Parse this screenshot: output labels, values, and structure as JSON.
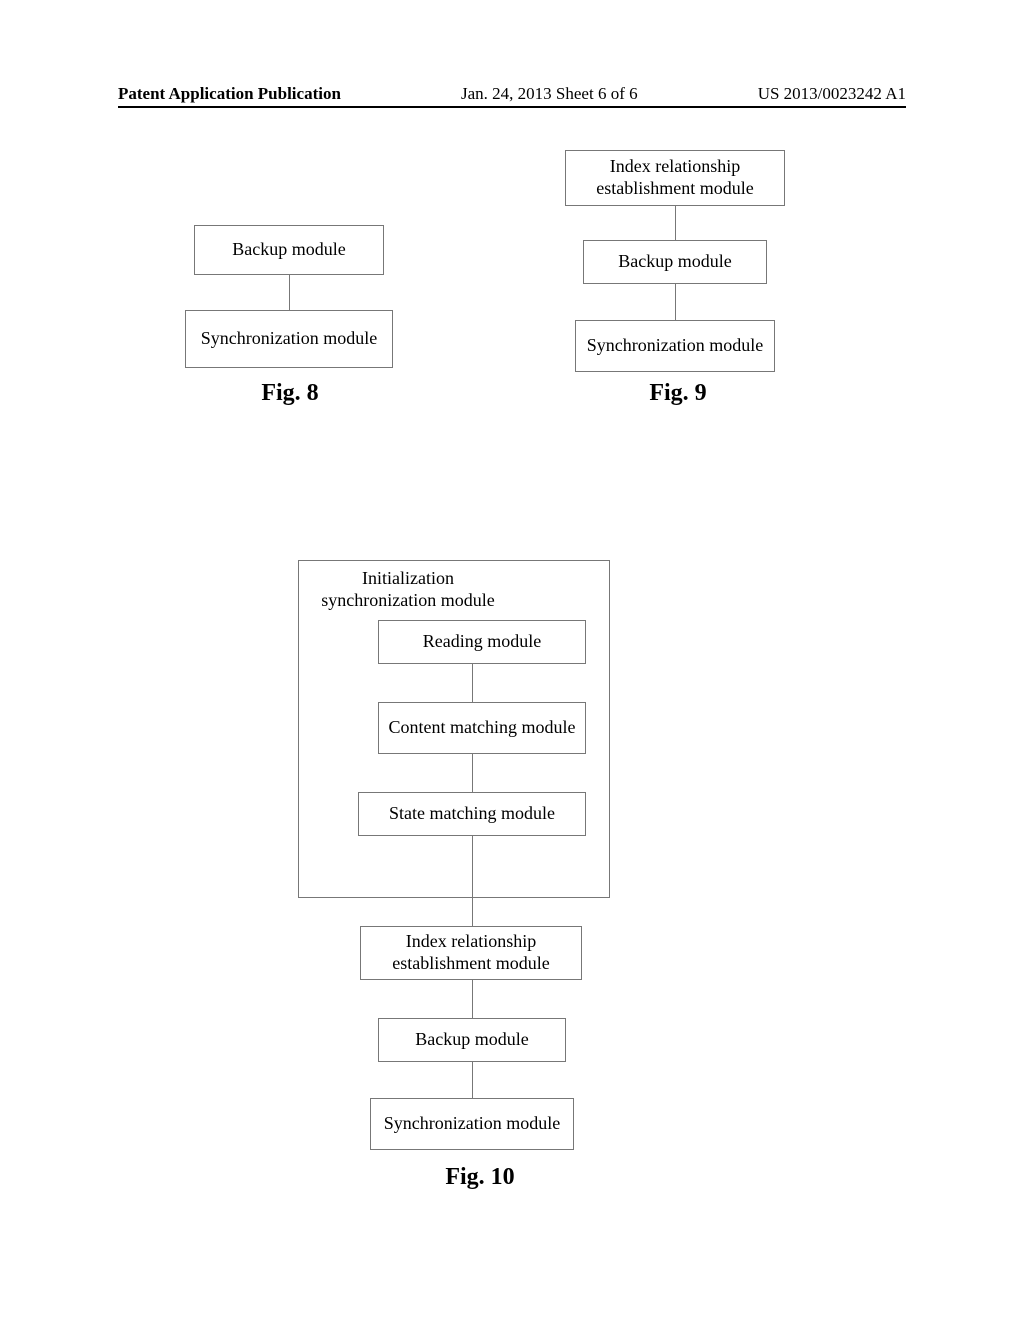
{
  "header": {
    "left": "Patent Application Publication",
    "center": "Jan. 24, 2013  Sheet 6 of 6",
    "right": "US 2013/0023242 A1"
  },
  "fig8": {
    "backup": "Backup module",
    "sync": "Synchronization module",
    "caption": "Fig. 8"
  },
  "fig9": {
    "index": "Index relationship establishment module",
    "backup": "Backup module",
    "sync": "Synchronization module",
    "caption": "Fig. 9"
  },
  "fig10": {
    "outer_label": "Initialization synchronization module",
    "reading": "Reading module",
    "content_match": "Content matching module",
    "state_match": "State matching module",
    "index": "Index relationship establishment module",
    "backup": "Backup module",
    "sync": "Synchronization module",
    "caption": "Fig. 10"
  }
}
